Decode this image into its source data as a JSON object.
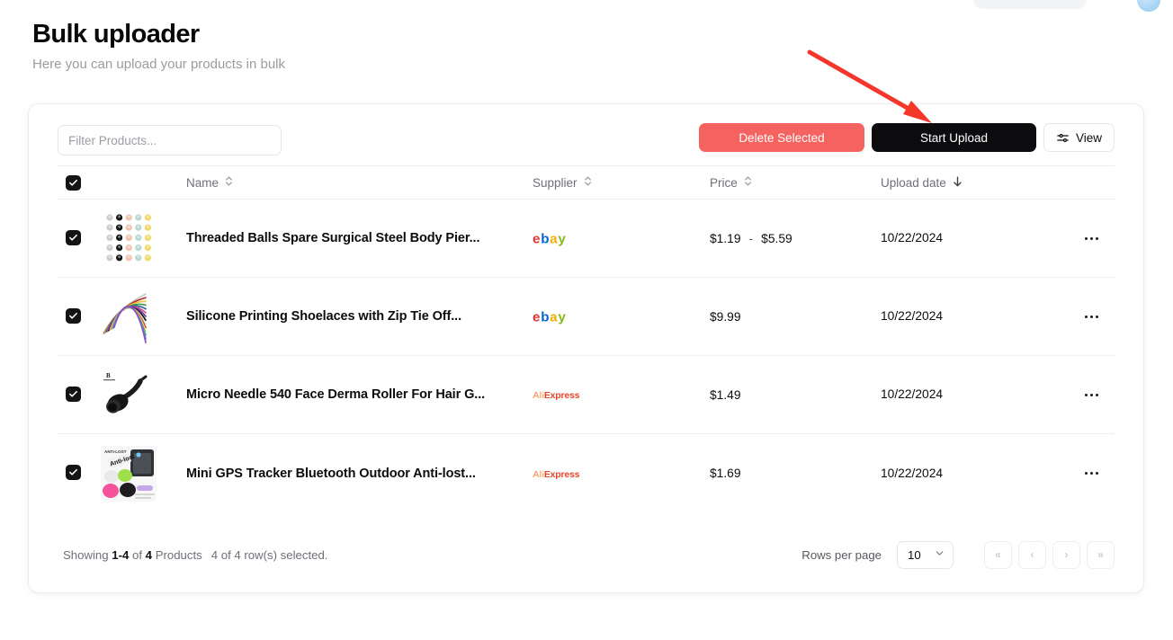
{
  "header": {
    "title": "Bulk uploader",
    "subtitle": "Here you can upload your products in bulk"
  },
  "toolbar": {
    "filter_placeholder": "Filter Products...",
    "filter_value": "",
    "delete_label": "Delete Selected",
    "start_upload_label": "Start Upload",
    "view_label": "View"
  },
  "table": {
    "columns": {
      "name": "Name",
      "supplier": "Supplier",
      "price": "Price",
      "date": "Upload date"
    },
    "sort": {
      "active_column": "Upload date",
      "direction": "desc"
    },
    "rows": [
      {
        "selected": true,
        "name": "Threaded Balls Spare Surgical Steel Body Pier...",
        "supplier": "ebay",
        "price_min": "$1.19",
        "price_sep": "-",
        "price_max": "$5.59",
        "date": "10/22/2024",
        "image": "ball-grid"
      },
      {
        "selected": true,
        "name": "Silicone Printing Shoelaces with Zip Tie Off...",
        "supplier": "ebay",
        "price_min": "$9.99",
        "price_sep": "",
        "price_max": "",
        "date": "10/22/2024",
        "image": "shoelaces"
      },
      {
        "selected": true,
        "name": "Micro Needle 540 Face Derma Roller For Hair G...",
        "supplier": "aliexpress",
        "price_min": "$1.49",
        "price_sep": "",
        "price_max": "",
        "date": "10/22/2024",
        "image": "derma-roller"
      },
      {
        "selected": true,
        "name": "Mini GPS Tracker Bluetooth Outdoor Anti-lost...",
        "supplier": "aliexpress",
        "price_min": "$1.69",
        "price_sep": "",
        "price_max": "",
        "date": "10/22/2024",
        "image": "gps-tracker"
      }
    ],
    "header_all_selected": true
  },
  "footer": {
    "showing_prefix": "Showing",
    "showing_range": "1-4",
    "showing_of": "of",
    "showing_total": "4",
    "showing_suffix": "Products",
    "rows_selected": "4 of 4 row(s) selected.",
    "rows_per_page_label": "Rows per page",
    "rows_per_page_value": "10",
    "pager": {
      "first": "«",
      "prev": "‹",
      "next": "›",
      "last": "»"
    }
  },
  "annotation": {
    "arrow_color": "#f5372b"
  },
  "colors": {
    "danger": "#f4635f",
    "primary": "#0c0c0f",
    "ebay_e": "#e53238",
    "ebay_b": "#0064d2",
    "ebay_a": "#f5af02",
    "ebay_y": "#86b817",
    "aliexpress": "#e8452c"
  }
}
